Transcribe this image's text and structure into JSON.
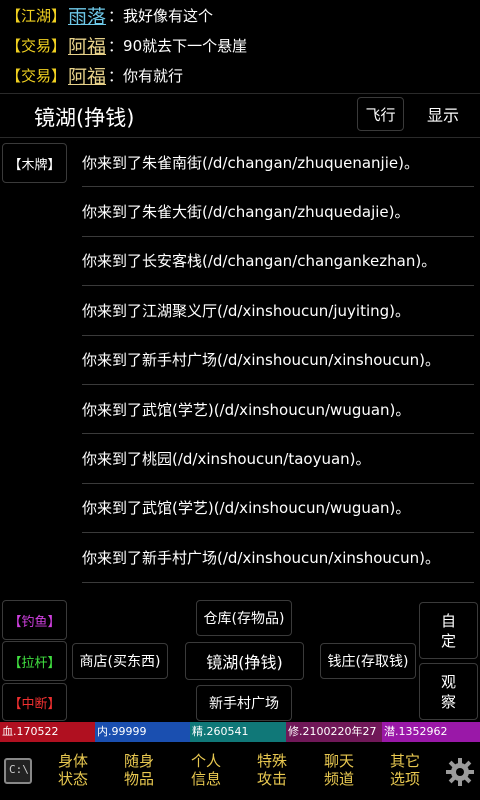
{
  "chat": [
    {
      "channel": "【江湖】",
      "name": "雨落",
      "message": "我好像有这个",
      "name_color": "blue"
    },
    {
      "channel": "【交易】",
      "name": "阿福",
      "message": "90就去下一个悬崖",
      "name_color": "gold"
    },
    {
      "channel": "【交易】",
      "name": "阿福",
      "message": "你有就行",
      "name_color": "gold"
    }
  ],
  "chat_colon": "：",
  "location": {
    "title": "镜湖(挣钱)",
    "fly_label": "飞行",
    "show_label": "显示"
  },
  "wood_label": "【木牌】",
  "log": [
    "你来到了朱雀南街(/d/changan/zhuquenanjie)。",
    "你来到了朱雀大街(/d/changan/zhuquedajie)。",
    "你来到了长安客栈(/d/changan/changankezhan)。",
    "你来到了江湖聚义厅(/d/xinshoucun/juyiting)。",
    "你来到了新手村广场(/d/xinshoucun/xinshoucun)。",
    "你来到了武馆(学艺)(/d/xinshoucun/wuguan)。",
    "你来到了桃园(/d/xinshoucun/taoyuan)。",
    "你来到了武馆(学艺)(/d/xinshoucun/wuguan)。",
    "你来到了新手村广场(/d/xinshoucun/xinshoucun)。"
  ],
  "actions": {
    "fish": "【钓鱼】",
    "pull": "【拉杆】",
    "stop": "【中断】"
  },
  "exits": {
    "warehouse": "仓库(存物品)",
    "shop": "商店(买东西)",
    "here": "镜湖(挣钱)",
    "bank": "钱庄(存取钱)",
    "village": "新手村广场"
  },
  "side": {
    "custom": "自\n定",
    "watch": "观\n察"
  },
  "stats": [
    {
      "label": "血.170522",
      "color": "#b01020"
    },
    {
      "label": "内.99999",
      "color": "#1a4fb0"
    },
    {
      "label": "精.260541",
      "color": "#107878"
    },
    {
      "label": "修.2100220年27",
      "color": "#701858"
    },
    {
      "label": "潜.1352962",
      "color": "#9a18a8"
    }
  ],
  "nav": [
    {
      "label": "身体\n状态"
    },
    {
      "label": "随身\n物品"
    },
    {
      "label": "个人\n信息"
    },
    {
      "label": "特殊\n攻击"
    },
    {
      "label": "聊天\n频道"
    },
    {
      "label": "其它\n选项"
    }
  ],
  "console_glyph": "C:\\",
  "colors": {
    "channel": "#f0d020",
    "nav": "#e8c850",
    "fish": "#d040e0",
    "pull": "#40e040",
    "stop": "#f03030"
  }
}
